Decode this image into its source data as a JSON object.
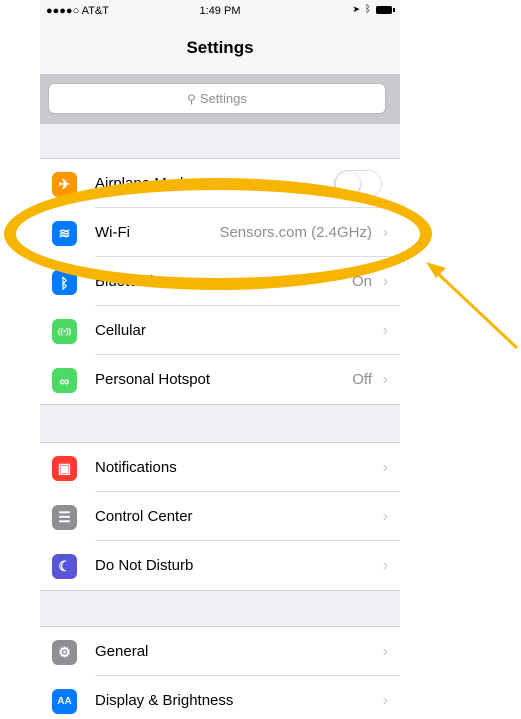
{
  "status_bar": {
    "carrier": "●●●●○ AT&T",
    "time": "1:49 PM",
    "icons": [
      "wifi-icon",
      "location-icon",
      "bluetooth-icon",
      "battery-icon"
    ]
  },
  "nav": {
    "title": "Settings"
  },
  "search": {
    "placeholder": "Settings"
  },
  "groups": [
    {
      "rows": [
        {
          "label": "Airplane Mode",
          "icon": "airplane-icon",
          "color": "#ff9500",
          "toggle": "off"
        },
        {
          "label": "Wi-Fi",
          "icon": "wifi-icon",
          "color": "#007aff",
          "value": "Sensors.com (2.4GHz)"
        },
        {
          "label": "Bluetooth",
          "icon": "bluetooth-icon",
          "color": "#007aff",
          "value": "On"
        },
        {
          "label": "Cellular",
          "icon": "cellular-icon",
          "color": "#4cd964"
        },
        {
          "label": "Personal Hotspot",
          "icon": "hotspot-icon",
          "color": "#4cd964",
          "value": "Off"
        }
      ]
    },
    {
      "rows": [
        {
          "label": "Notifications",
          "icon": "notifications-icon",
          "color": "#ff3b30"
        },
        {
          "label": "Control Center",
          "icon": "control-center-icon",
          "color": "#8e8e93"
        },
        {
          "label": "Do Not Disturb",
          "icon": "moon-icon",
          "color": "#5856d6"
        }
      ]
    },
    {
      "rows": [
        {
          "label": "General",
          "icon": "gear-icon",
          "color": "#8e8e93"
        },
        {
          "label": "Display & Brightness",
          "icon": "display-icon",
          "color": "#007aff"
        }
      ]
    }
  ],
  "glyphs": {
    "chevron": "›",
    "search_icon": "⚲",
    "airplane": "✈",
    "wifi": "≋",
    "bluetooth": "ᛒ",
    "cellular": "((•))",
    "hotspot": "∞",
    "notifications": "▣",
    "control_center": "☰",
    "moon": "☾",
    "gear": "⚙",
    "display": "AA",
    "location": "➤",
    "bt_status": "ᛒ"
  },
  "annotation": {
    "highlight_color": "#f7b500",
    "target": "Wi-Fi"
  }
}
